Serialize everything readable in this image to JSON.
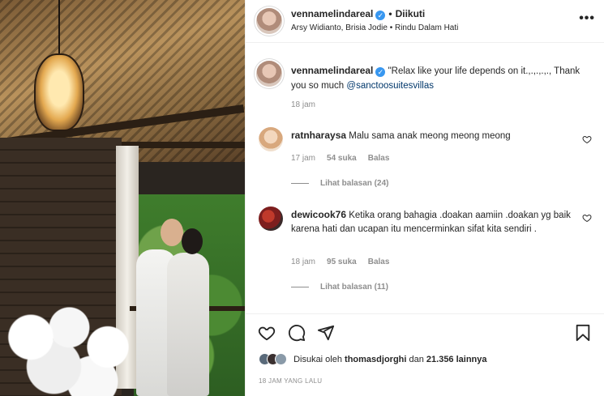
{
  "header": {
    "username": "vennamelindareal",
    "follow_label": "Diikuti",
    "subtitle": "Arsy Widianto, Brisia Jodie • Rindu Dalam Hati",
    "more_label": "•••"
  },
  "caption": {
    "username": "vennamelindareal",
    "text": "\"Relax like your life depends on it.,.,.,.,., Thank you so much ",
    "mention": "@sanctoosuitesvillas",
    "time": "18 jam"
  },
  "comments": [
    {
      "username": "ratnharaysa",
      "text": "Malu sama anak meong meong meong",
      "time": "17 jam",
      "likes": "54 suka",
      "reply_label": "Balas",
      "view_replies": "Lihat balasan (24)",
      "avatar_color": "#e9c9a8"
    },
    {
      "username": "dewicook76",
      "text": "Ketika orang bahagia .doakan aamiin .doakan yg baik karena hati dan ucapan itu mencerminkan sifat kita sendiri .",
      "time": "18 jam",
      "likes": "95 suka",
      "reply_label": "Balas",
      "view_replies": "Lihat balasan (11)",
      "avatar_color": "#8a2a2a"
    }
  ],
  "footer": {
    "liked_prefix": "Disukai oleh ",
    "liked_user": "thomasdjorghi",
    "liked_middle": " dan ",
    "liked_count": "21.356 lainnya",
    "timestamp": "18 JAM YANG LALU"
  },
  "icons": {
    "like": "heart-icon",
    "comment": "comment-icon",
    "share": "share-icon",
    "save": "bookmark-icon",
    "verified": "verified-badge-icon"
  },
  "colors": {
    "verified": "#3897f0",
    "text": "#262626",
    "muted": "#8e8e8e",
    "link": "#00376b"
  }
}
